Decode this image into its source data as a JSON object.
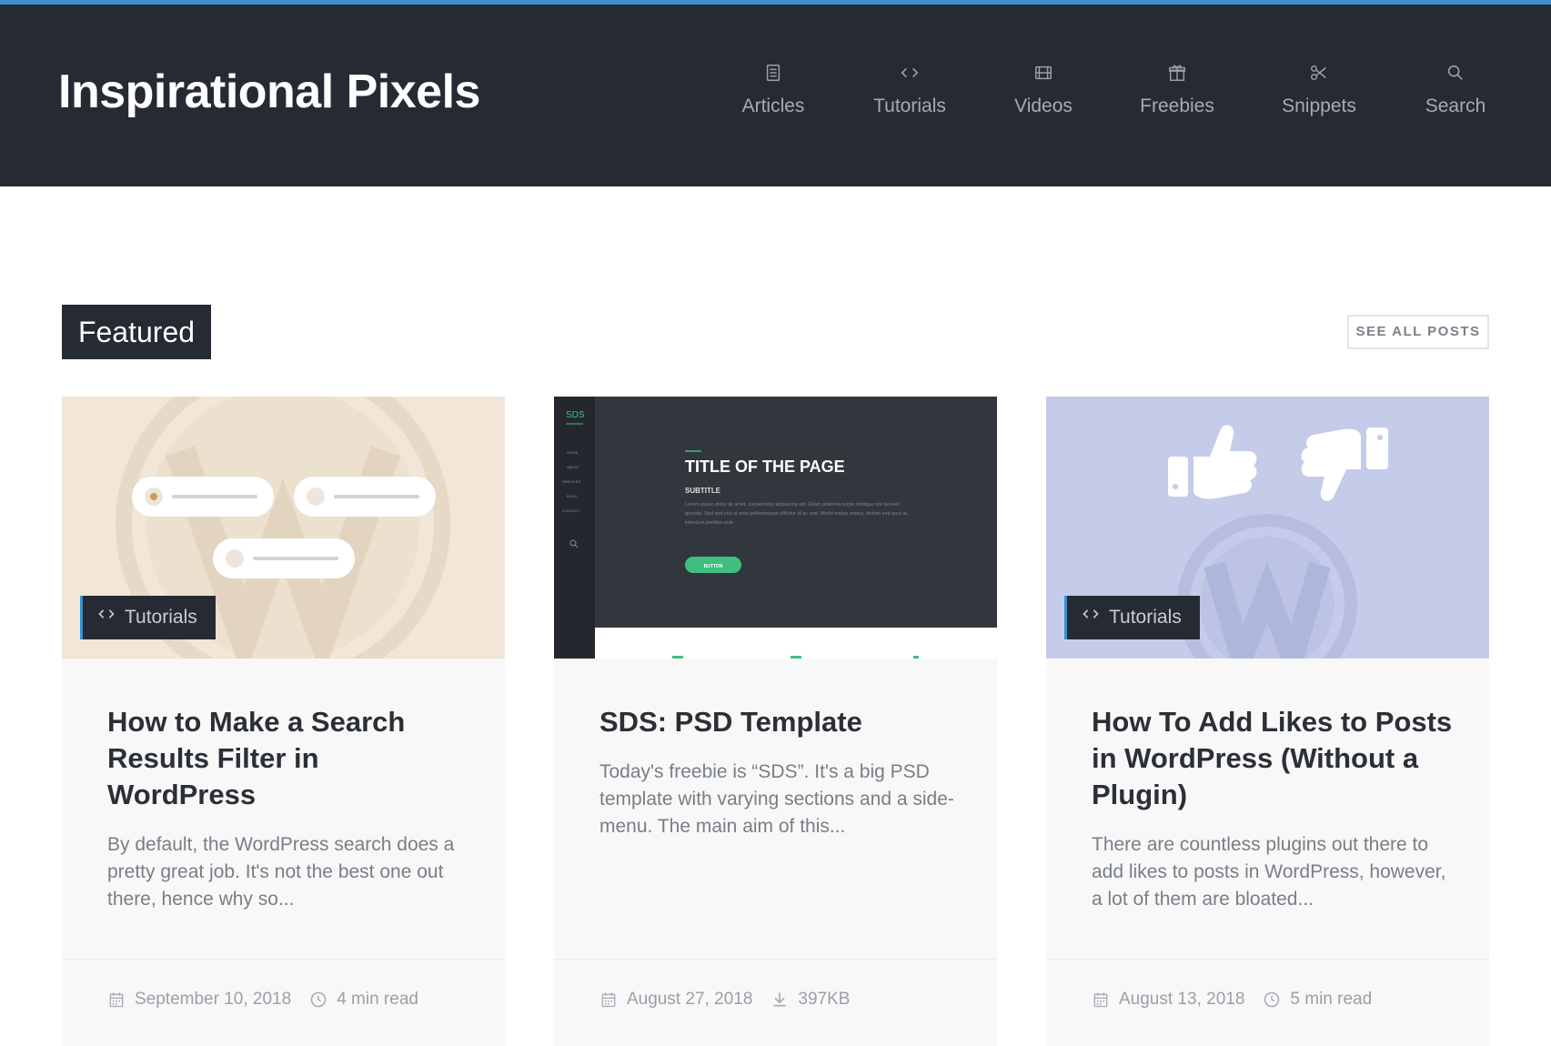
{
  "site": {
    "brand": "Inspirational Pixels",
    "accent": "#3a8fd0",
    "header_bg": "#262a33"
  },
  "nav": [
    {
      "label": "Articles",
      "icon": "document-icon"
    },
    {
      "label": "Tutorials",
      "icon": "code-icon"
    },
    {
      "label": "Videos",
      "icon": "film-icon"
    },
    {
      "label": "Freebies",
      "icon": "gift-icon"
    },
    {
      "label": "Snippets",
      "icon": "scissors-icon"
    },
    {
      "label": "Search",
      "icon": "search-icon"
    }
  ],
  "section": {
    "title": "Featured",
    "see_all": "SEE ALL POSTS"
  },
  "cards": [
    {
      "category": "Tutorials",
      "title": "How to Make a Search Results Filter in WordPress",
      "excerpt": "By default, the WordPress search does a pretty great job. It's not the best one out there, hence why so...",
      "date": "September 10, 2018",
      "meta2": "4 min read",
      "meta2_icon": "clock-icon",
      "image_bg": "#f1e6d8"
    },
    {
      "category": "",
      "title": "SDS: PSD Template",
      "excerpt": "Today's freebie is “SDS”. It's a big PSD template with varying sections and a side-menu. The main aim of this...",
      "date": "August 27, 2018",
      "meta2": "397KB",
      "meta2_icon": "download-icon",
      "image_bg": "#32363d",
      "preview": {
        "logo": "SDS",
        "menu": [
          "WORK",
          "ABOUT",
          "SERVICES",
          "BLOG",
          "CONTACT"
        ],
        "title": "TITLE OF THE PAGE",
        "subtitle": "SUBTITLE",
        "body": "Lorem ipsum dolor sit amet, consectetur adipiscing elit. Etiam pharetra turpis tristique nisi laoreet gravida. Sed sed orci ut ante pellentesque efficitur id ac erat. Morbi metus metus, dictum sed arcu at, interdum porttitor erat.",
        "button": "BUTTON"
      }
    },
    {
      "category": "Tutorials",
      "title": "How To Add Likes to Posts in WordPress (Without a Plugin)",
      "excerpt": "There are countless plugins out there to add likes to posts in WordPress, however, a lot of them are bloated...",
      "date": "August 13, 2018",
      "meta2": "5 min read",
      "meta2_icon": "clock-icon",
      "image_bg": "#c5cce9"
    }
  ]
}
